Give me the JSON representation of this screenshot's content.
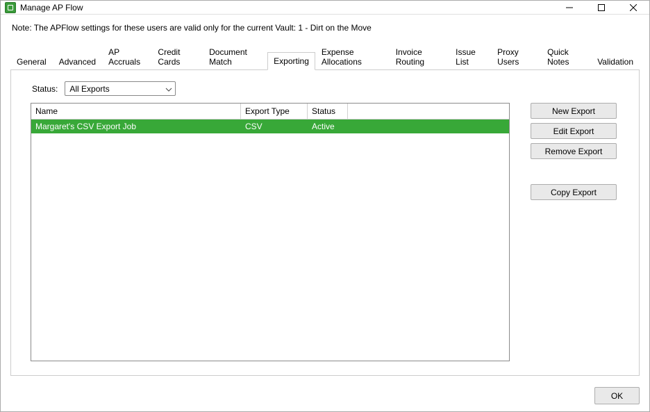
{
  "window": {
    "title": "Manage AP Flow"
  },
  "note": "Note:  The APFlow settings for these users are valid only for the current Vault: 1 - Dirt on the Move",
  "tabs": {
    "items": [
      {
        "label": "General"
      },
      {
        "label": "Advanced"
      },
      {
        "label": "AP Accruals"
      },
      {
        "label": "Credit Cards"
      },
      {
        "label": "Document Match"
      },
      {
        "label": "Exporting"
      },
      {
        "label": "Expense Allocations"
      },
      {
        "label": "Invoice Routing"
      },
      {
        "label": "Issue List"
      },
      {
        "label": "Proxy Users"
      },
      {
        "label": "Quick Notes"
      },
      {
        "label": "Validation"
      }
    ],
    "active_index": 5
  },
  "status_filter": {
    "label": "Status:",
    "selected": "All Exports"
  },
  "table": {
    "columns": {
      "name": "Name",
      "export_type": "Export Type",
      "status": "Status"
    },
    "rows": [
      {
        "name": "Margaret's CSV Export Job",
        "export_type": "CSV",
        "status": "Active",
        "selected": true
      }
    ]
  },
  "buttons": {
    "new_export": "New Export",
    "edit_export": "Edit Export",
    "remove_export": "Remove Export",
    "copy_export": "Copy Export",
    "ok": "OK"
  }
}
